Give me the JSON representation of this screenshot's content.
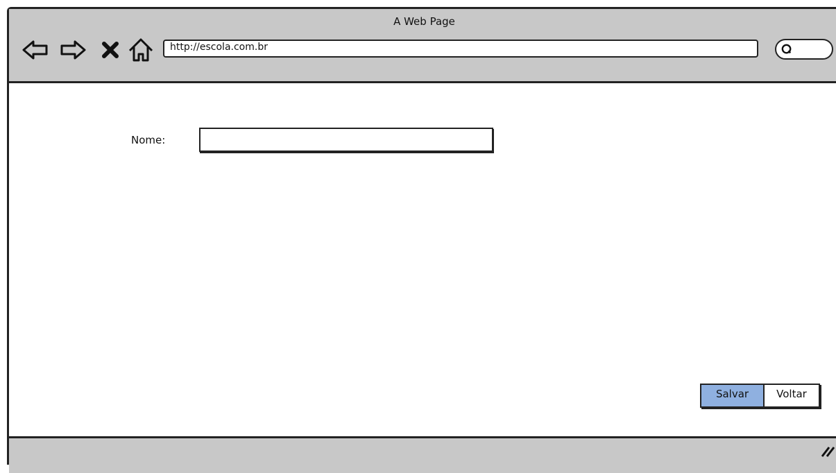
{
  "browser": {
    "title": "A Web Page",
    "url": "http://escola.com.br",
    "nav_icons": [
      "back-arrow-icon",
      "forward-arrow-icon",
      "stop-icon",
      "home-icon",
      "search-icon"
    ]
  },
  "form": {
    "nome_label": "Nome:",
    "nome_value": ""
  },
  "buttons": {
    "save_label": "Salvar",
    "back_label": "Voltar"
  },
  "colors": {
    "chrome": "#c8c8c8",
    "selected_button": "#8fb0e0",
    "border": "#222222"
  }
}
